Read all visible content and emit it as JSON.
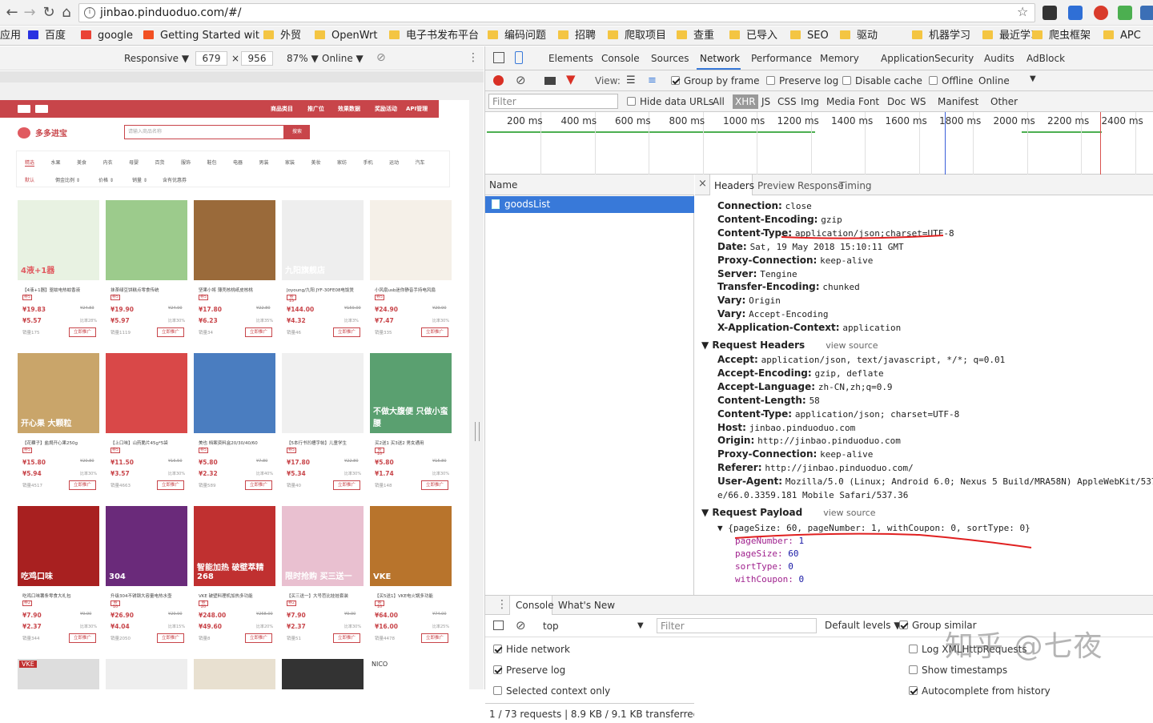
{
  "browser": {
    "url": "jinbao.pinduoduo.com/#/"
  },
  "bookmarks": [
    {
      "label": "应用",
      "icon": "apps-icon"
    },
    {
      "label": "百度",
      "icon": "baidu-icon"
    },
    {
      "label": "google",
      "icon": "google-icon"
    },
    {
      "label": "Getting Started wit",
      "icon": "windows-icon"
    },
    {
      "label": "外贸",
      "icon": "folder-icon"
    },
    {
      "label": "OpenWrt",
      "icon": "folder-icon"
    },
    {
      "label": "电子书发布平台",
      "icon": "folder-icon"
    },
    {
      "label": "编码问题",
      "icon": "folder-icon"
    },
    {
      "label": "招聘",
      "icon": "folder-icon"
    },
    {
      "label": "爬取项目",
      "icon": "folder-icon"
    },
    {
      "label": "查重",
      "icon": "folder-icon"
    },
    {
      "label": "已导入",
      "icon": "folder-icon"
    },
    {
      "label": "SEO",
      "icon": "folder-icon"
    },
    {
      "label": "驱动",
      "icon": "folder-icon"
    },
    {
      "label": "机器学习",
      "icon": "folder-icon"
    },
    {
      "label": "最近学习",
      "icon": "folder-icon"
    },
    {
      "label": "爬虫框架",
      "icon": "folder-icon"
    },
    {
      "label": "APC",
      "icon": "folder-icon"
    }
  ],
  "device": {
    "mode": "Responsive",
    "width": "679",
    "height": "956",
    "zoom": "87%",
    "network": "Online"
  },
  "page": {
    "header_menu": [
      "商品类目",
      "推广位",
      "效果数据",
      "奖励活动",
      "API管理"
    ],
    "logo": "多多进宝",
    "search_placeholder": "请输入商品名称",
    "search_button": "搜索",
    "categories": [
      "精选",
      "水果",
      "美食",
      "内衣",
      "母婴",
      "百货",
      "服饰",
      "鞋包",
      "电器",
      "男装",
      "家装",
      "美妆",
      "家纺",
      "手机",
      "运动",
      "汽车"
    ],
    "sorts": [
      "默认",
      "佣金比例 ⇕",
      "价格 ⇕",
      "销量 ⇕",
      "含有优惠券"
    ],
    "row1": [
      {
        "title": "【4液+1器】驱蚊电热蚊香液",
        "badge": "券5",
        "price": "¥19.83",
        "orig": "¥24.83",
        "promo": "¥5.57",
        "sales": "销量175",
        "rate": "比率28%",
        "btn": "立即推广",
        "img": "4液+1器"
      },
      {
        "title": "抹茶绿豆饼糕点零食传统",
        "badge": "券5",
        "price": "¥19.90",
        "orig": "¥24.90",
        "promo": "¥5.97",
        "sales": "销量1119",
        "rate": "比率30%",
        "btn": "立即推广",
        "img": ""
      },
      {
        "title": "坚果小将 薄壳核桃纸皮核桃",
        "badge": "券5",
        "price": "¥17.80",
        "orig": "¥22.80",
        "promo": "¥6.23",
        "sales": "销量34",
        "rate": "比率35%",
        "btn": "立即推广",
        "img": ""
      },
      {
        "title": "Joyoung/九阳 JYF-30FE08电饭煲",
        "badge": "券15",
        "price": "¥144.00",
        "orig": "¥159.00",
        "promo": "¥4.32",
        "sales": "销量46",
        "rate": "比率3%",
        "btn": "立即推广",
        "img": "九阳旗舰店"
      },
      {
        "title": "小风扇usb迷你静音手持电风扇",
        "badge": "券5",
        "price": "¥24.90",
        "orig": "¥29.90",
        "promo": "¥7.47",
        "sales": "销量335",
        "rate": "比率30%",
        "btn": "立即推广",
        "img": ""
      }
    ],
    "row2": [
      {
        "title": "【花粿子】盐焗开心果250g",
        "badge": "券5",
        "price": "¥15.80",
        "orig": "¥20.80",
        "promo": "¥5.94",
        "sales": "销量4517",
        "rate": "比率30%",
        "btn": "立即推广",
        "img": "开心果 大颗粒"
      },
      {
        "title": "【上口味】山药脆片45g*5袋",
        "badge": "券5",
        "price": "¥11.50",
        "orig": "¥16.50",
        "promo": "¥3.57",
        "sales": "销量4663",
        "rate": "比率30%",
        "btn": "立即推广",
        "img": ""
      },
      {
        "title": "美也 档案资料盒20/30/40/60",
        "badge": "券5",
        "price": "¥5.80",
        "orig": "¥7.80",
        "promo": "¥2.32",
        "sales": "销量589",
        "rate": "比率40%",
        "btn": "立即推广",
        "img": ""
      },
      {
        "title": "【5本行书凹槽字帖】儿童学生",
        "badge": "券5",
        "price": "¥17.80",
        "orig": "¥22.80",
        "promo": "¥5.34",
        "sales": "销量40",
        "rate": "比率30%",
        "btn": "立即推广",
        "img": ""
      },
      {
        "title": "买2送1 买3送2 男女通用",
        "badge": "券10",
        "price": "¥5.80",
        "orig": "¥15.80",
        "promo": "¥1.74",
        "sales": "销量148",
        "rate": "比率30%",
        "btn": "立即推广",
        "img": "不做大腹便 只做小蛮腰"
      }
    ],
    "row3": [
      {
        "title": "吃鸡口味薯条零食大礼包",
        "badge": "券2",
        "price": "¥7.90",
        "orig": "¥9.90",
        "promo": "¥2.37",
        "sales": "销量344",
        "rate": "比率30%",
        "btn": "立即推广",
        "img": "吃鸡口味"
      },
      {
        "title": "升级304不锈钢大容量电热水壶",
        "badge": "券10",
        "price": "¥26.90",
        "orig": "¥29.90",
        "promo": "¥4.04",
        "sales": "销量2050",
        "rate": "比率15%",
        "btn": "立即推广",
        "img": "304"
      },
      {
        "title": "VKE 破壁料理机加热多功能",
        "badge": "券20",
        "price": "¥248.00",
        "orig": "¥268.00",
        "promo": "¥49.60",
        "sales": "销量8",
        "rate": "比率20%",
        "btn": "立即推广",
        "img": "智能加热 破壁萃精 268"
      },
      {
        "title": "【买三送一】大号芭比娃娃套装",
        "badge": "券2",
        "price": "¥7.90",
        "orig": "¥9.90",
        "promo": "¥2.37",
        "sales": "销量51",
        "rate": "比率30%",
        "btn": "立即推广",
        "img": "限时抢购 买三送一"
      },
      {
        "title": "【买5送1】VKE电火锅多功能",
        "badge": "券10",
        "price": "¥64.00",
        "orig": "¥74.00",
        "promo": "¥16.00",
        "sales": "销量4478",
        "rate": "比率25%",
        "btn": "立即推广",
        "img": "VKE"
      }
    ],
    "row4_labels": [
      "VKE",
      "",
      "",
      "",
      "NICO"
    ]
  },
  "devtools": {
    "tabs": [
      "Elements",
      "Console",
      "Sources",
      "Network",
      "Performance",
      "Memory",
      "Application",
      "Security",
      "Audits",
      "AdBlock"
    ],
    "active_tab": "Network",
    "toolbar": {
      "view": "View:",
      "group_by_frame": "Group by frame",
      "preserve_log": "Preserve log",
      "disable_cache": "Disable cache",
      "offline": "Offline",
      "online": "Online"
    },
    "filter": {
      "placeholder": "Filter",
      "hide_data_urls": "Hide data URLs",
      "types": [
        "All",
        "XHR",
        "JS",
        "CSS",
        "Img",
        "Media",
        "Font",
        "Doc",
        "WS",
        "Manifest",
        "Other"
      ],
      "active": "XHR"
    },
    "timeline_ticks": [
      "200 ms",
      "400 ms",
      "600 ms",
      "800 ms",
      "1000 ms",
      "1200 ms",
      "1400 ms",
      "1600 ms",
      "1800 ms",
      "2000 ms",
      "2200 ms",
      "2400 ms"
    ],
    "name_header": "Name",
    "request": "goodsList",
    "summary": "1 / 73 requests  |  8.9 KB / 9.1 KB transferred  |  ...",
    "detail_tabs": [
      "Headers",
      "Preview",
      "Response",
      "Timing"
    ],
    "response_headers": [
      {
        "k": "Connection:",
        "v": "close"
      },
      {
        "k": "Content-Encoding:",
        "v": "gzip"
      },
      {
        "k": "Content-Type:",
        "v": "application/json;charset=UTF-8"
      },
      {
        "k": "Date:",
        "v": "Sat, 19 May 2018 15:10:11 GMT"
      },
      {
        "k": "Proxy-Connection:",
        "v": "keep-alive"
      },
      {
        "k": "Server:",
        "v": "Tengine"
      },
      {
        "k": "Transfer-Encoding:",
        "v": "chunked"
      },
      {
        "k": "Vary:",
        "v": "Origin"
      },
      {
        "k": "Vary:",
        "v": "Accept-Encoding"
      },
      {
        "k": "X-Application-Context:",
        "v": "application"
      }
    ],
    "request_headers_title": "Request Headers",
    "view_source": "view source",
    "request_headers": [
      {
        "k": "Accept:",
        "v": "application/json, text/javascript, */*; q=0.01"
      },
      {
        "k": "Accept-Encoding:",
        "v": "gzip, deflate"
      },
      {
        "k": "Accept-Language:",
        "v": "zh-CN,zh;q=0.9"
      },
      {
        "k": "Content-Length:",
        "v": "58"
      },
      {
        "k": "Content-Type:",
        "v": "application/json; charset=UTF-8"
      },
      {
        "k": "Host:",
        "v": "jinbao.pinduoduo.com"
      },
      {
        "k": "Origin:",
        "v": "http://jinbao.pinduoduo.com"
      },
      {
        "k": "Proxy-Connection:",
        "v": "keep-alive"
      },
      {
        "k": "Referer:",
        "v": "http://jinbao.pinduoduo.com/"
      },
      {
        "k": "User-Agent:",
        "v": "Mozilla/5.0 (Linux; Android 6.0; Nexus 5 Build/MRA58N) AppleWebKit/537.3"
      },
      {
        "k": "",
        "v": "e/66.0.3359.181 Mobile Safari/537.36"
      }
    ],
    "payload_title": "Request Payload",
    "payload_summary": "{pageSize: 60, pageNumber: 1, withCoupon: 0, sortType: 0}",
    "payload": [
      {
        "k": "pageNumber:",
        "v": "1"
      },
      {
        "k": "pageSize:",
        "v": "60"
      },
      {
        "k": "sortType:",
        "v": "0"
      },
      {
        "k": "withCoupon:",
        "v": "0"
      }
    ],
    "console": {
      "tabs": [
        "Console",
        "What's New"
      ],
      "context": "top",
      "filter": "Filter",
      "levels": "Default levels ▼",
      "group_similar": "Group similar",
      "opts_left": [
        "Hide network",
        "Preserve log",
        "Selected context only"
      ],
      "opts_right": [
        "Log XMLHttpRequests",
        "Show timestamps",
        "Autocomplete from history"
      ]
    }
  },
  "watermark": "知乎 @七夜"
}
